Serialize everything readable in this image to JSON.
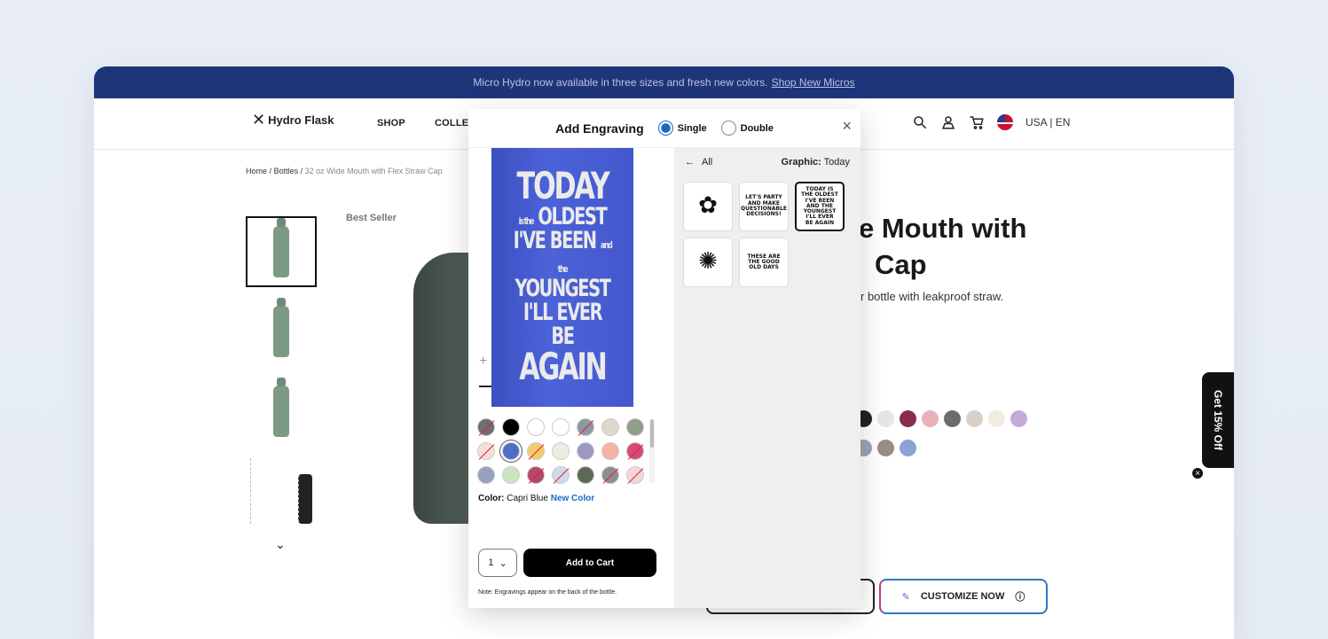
{
  "promo": {
    "text": "Micro Hydro now available in three sizes and fresh new colors.",
    "link": "Shop New Micros"
  },
  "nav": {
    "logo": "Hydro Flask",
    "shop": "SHOP",
    "collections": "COLLEC",
    "locale": "USA | EN"
  },
  "breadcrumb": {
    "home": "Home",
    "sep": "/",
    "bottles": "Bottles",
    "current": "32 oz Wide Mouth with Flex Straw Cap"
  },
  "product": {
    "badge": "Best Seller",
    "title_line1": "e Mouth with",
    "title_line2": "Cap",
    "subtitle": "r bottle with leakproof straw.",
    "customize": "CUSTOMIZE NOW"
  },
  "discount": {
    "label": "Get 15% Off",
    "close": "×"
  },
  "modal": {
    "title": "Add Engraving",
    "option_single": "Single",
    "option_double": "Double",
    "close": "×",
    "preview": {
      "line1": "TODAY",
      "line2a": "is the",
      "line2b": "OLDEST",
      "line3": "I'VE BEEN",
      "line3b": "and the",
      "line4": "YOUNGEST",
      "line5": "I'LL EVER BE",
      "line6": "AGAIN"
    },
    "color_label": "Color:",
    "color_value": "Capri Blue",
    "color_new": "New Color",
    "qty": "1",
    "add_to_cart": "Add to Cart",
    "note": "Note: Engravings appear on the back of the bottle.",
    "back_label": "All",
    "graphic_label": "Graphic:",
    "graphic_value": "Today",
    "graphics": [
      {
        "name": "graphic-rose",
        "text": "✿"
      },
      {
        "name": "graphic-lets-party",
        "text": "LET'S PARTY AND MAKE QUESTIONABLE DECISIONS!"
      },
      {
        "name": "graphic-today",
        "text": "TODAY IS THE OLDEST I'VE BEEN AND THE YOUNGEST I'LL EVER BE AGAIN"
      },
      {
        "name": "graphic-sun-trip",
        "text": "✺"
      },
      {
        "name": "graphic-good-old-days",
        "text": "THESE ARE THE GOOD OLD DAYS"
      }
    ]
  },
  "colors": {
    "modal_swatches": [
      "#6d6f6f",
      "#000000",
      "#ffffff",
      "#ffffff",
      "#8e98a3",
      "#ddd8cb",
      "#8f9e8b",
      "#f6ded9",
      "#4d6ec6",
      "#f0cc6b",
      "#efebe0",
      "#9c98c2",
      "#f6b2a2",
      "#d84a73",
      "#9aa0c0",
      "#c9e6c0",
      "#b4486b",
      "#cfd9ec",
      "#5d6a5a",
      "#8d8f8f",
      "#f3d6d6"
    ],
    "bg_swatches": [
      "#222",
      "#e6e6e6",
      "#8a2c4e",
      "#e8b3b8",
      "#6a6d70",
      "#d8cfc8",
      "#f0ece0",
      "#c6a9d9",
      "#9aa6b4",
      "#9b8a86",
      "#8aa2d4"
    ]
  }
}
